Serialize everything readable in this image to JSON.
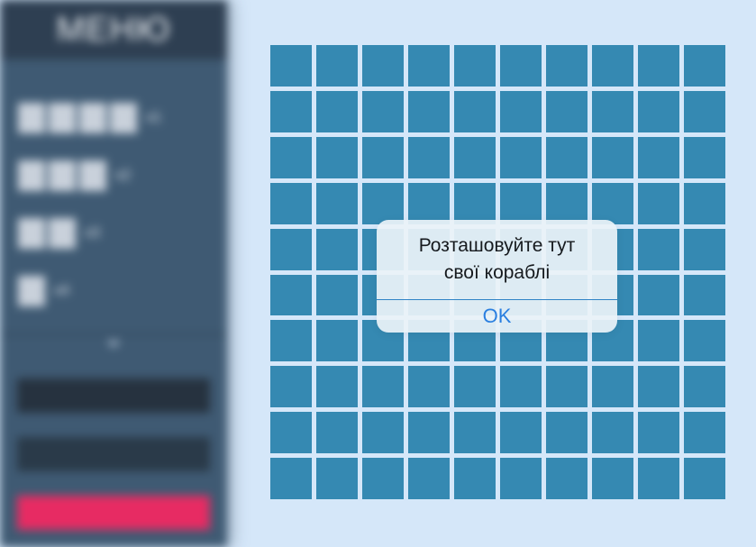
{
  "sidebar": {
    "title": "МЕНЮ",
    "fleet": [
      {
        "cells": 4,
        "count": "x1"
      },
      {
        "cells": 3,
        "count": "x2"
      },
      {
        "cells": 2,
        "count": "x3"
      },
      {
        "cells": 1,
        "count": "x4"
      }
    ],
    "buttons": [
      "",
      "",
      ""
    ],
    "accent_color": "#e72b63"
  },
  "board": {
    "rows": 10,
    "cols": 10,
    "cell_color": "#3589b2"
  },
  "modal": {
    "message_line1": "Розташовуйте тут",
    "message_line2": "свої кораблі",
    "ok_label": "OK"
  }
}
